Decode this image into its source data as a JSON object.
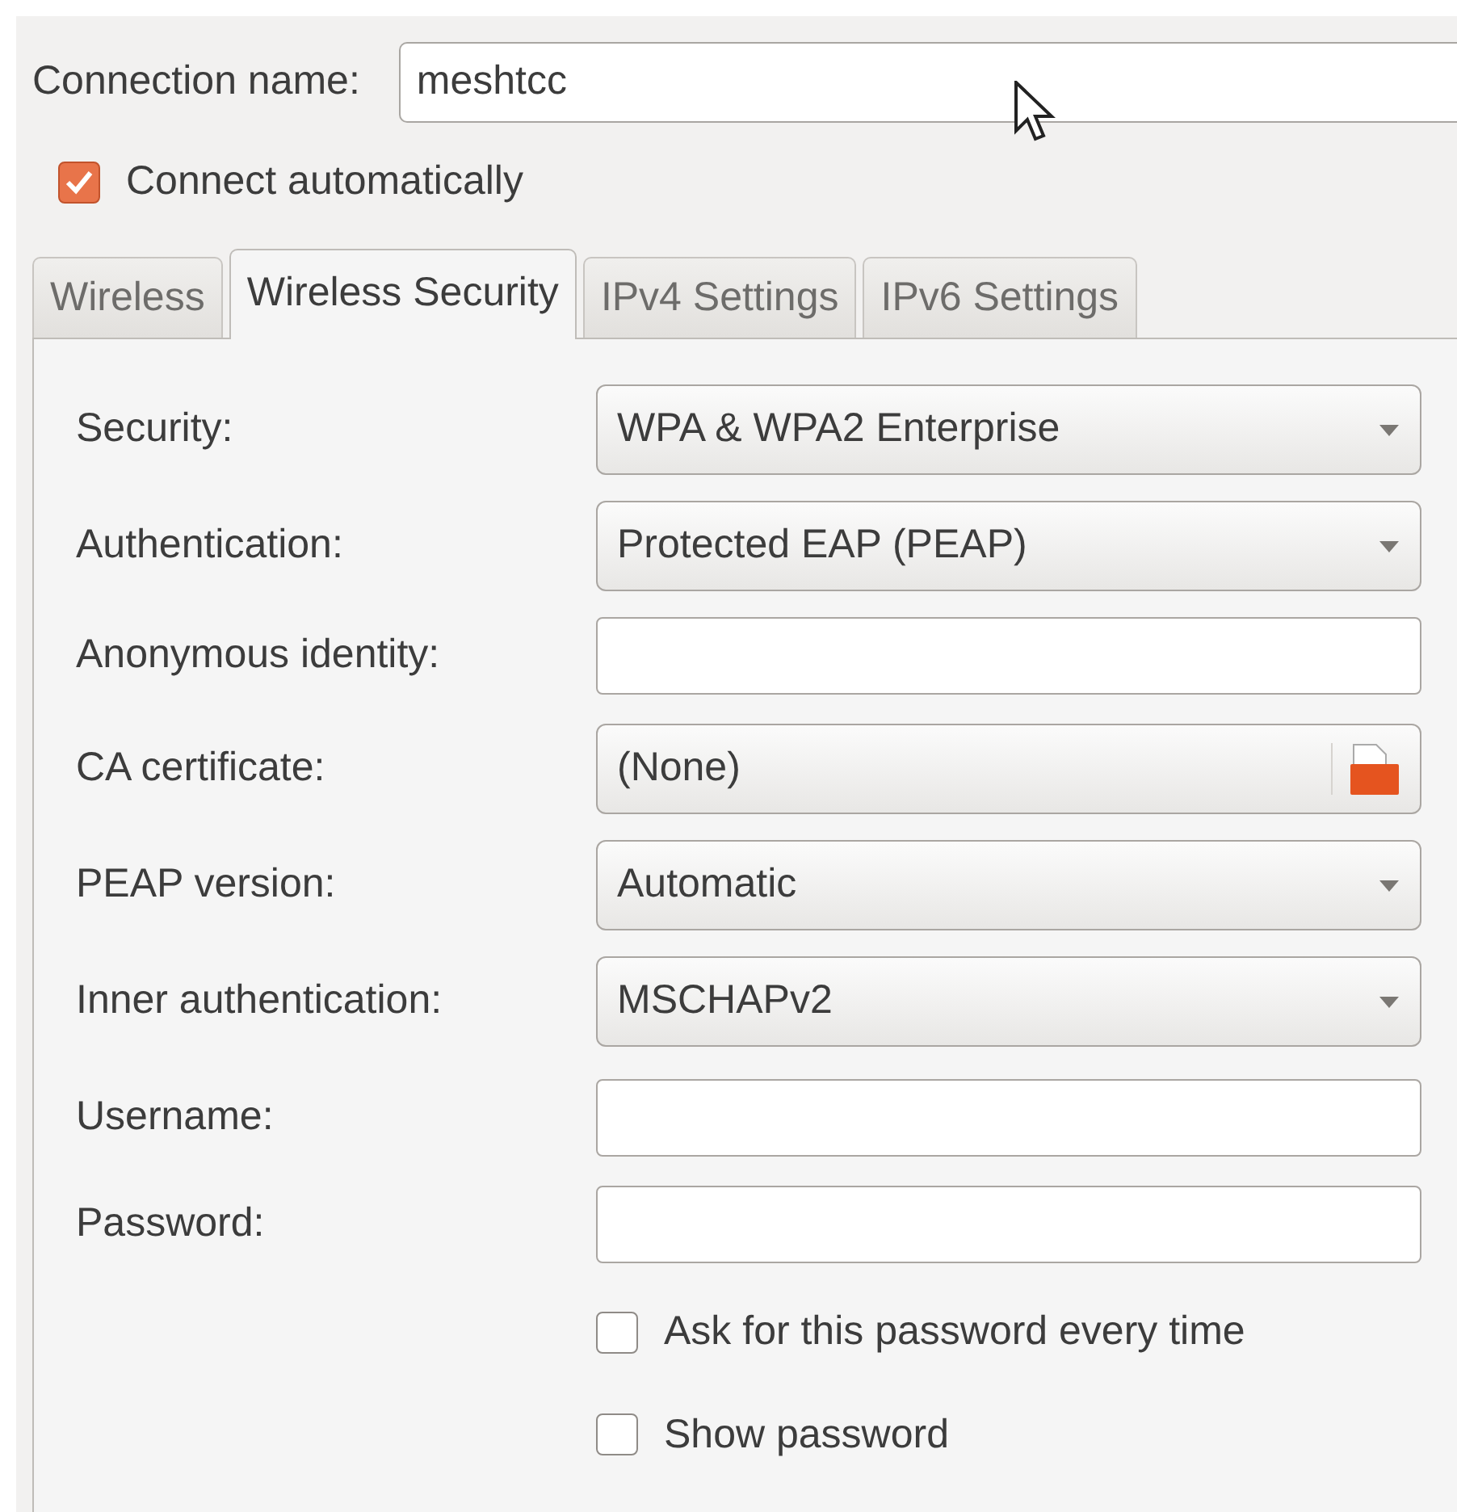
{
  "connection_name": {
    "label": "Connection name:",
    "value": "meshtcc"
  },
  "connect_automatically": {
    "label": "Connect automatically",
    "checked": true
  },
  "tabs": [
    {
      "label": "Wireless",
      "selected": false
    },
    {
      "label": "Wireless Security",
      "selected": true
    },
    {
      "label": "IPv4 Settings",
      "selected": false
    },
    {
      "label": "IPv6 Settings",
      "selected": false
    }
  ],
  "fields": [
    {
      "kind": "dropdown",
      "label": "Security:",
      "value": "WPA & WPA2 Enterprise"
    },
    {
      "kind": "dropdown",
      "label": "Authentication:",
      "value": "Protected EAP (PEAP)"
    },
    {
      "kind": "text",
      "label": "Anonymous identity:"
    },
    {
      "kind": "file",
      "label": "CA certificate:",
      "value": "(None)"
    },
    {
      "kind": "dropdown",
      "label": "PEAP version:",
      "value": "Automatic"
    },
    {
      "kind": "dropdown",
      "label": "Inner authentication:",
      "value": "MSCHAPv2"
    },
    {
      "kind": "text",
      "label": "Username:"
    },
    {
      "kind": "text",
      "label": "Password:"
    }
  ],
  "options": [
    {
      "label": "Ask for this password every time",
      "checked": false
    },
    {
      "label": "Show password",
      "checked": false
    }
  ]
}
